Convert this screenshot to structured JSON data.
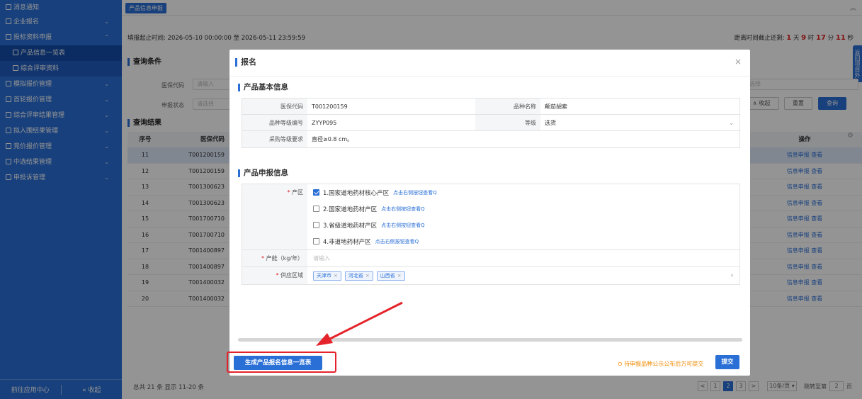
{
  "sidebar": {
    "items": [
      {
        "label": "消息通知",
        "icon": "notice-icon",
        "chevron": ""
      },
      {
        "label": "企业报名",
        "icon": "folder-icon",
        "chevron": "⌄"
      },
      {
        "label": "投标资料申报",
        "icon": "folder-icon",
        "chevron": "⌃"
      },
      {
        "label": "产品信息一览表",
        "icon": "doc-icon",
        "chevron": "",
        "sub": true,
        "active": true
      },
      {
        "label": "综合评审资料",
        "icon": "doc-icon",
        "chevron": "",
        "sub": true
      },
      {
        "label": "模拟报价管理",
        "icon": "folder-icon",
        "chevron": "⌄"
      },
      {
        "label": "首轮报价管理",
        "icon": "folder-icon",
        "chevron": "⌄"
      },
      {
        "label": "综合评审结果管理",
        "icon": "folder-icon",
        "chevron": "⌄"
      },
      {
        "label": "拟入围结果管理",
        "icon": "folder-icon",
        "chevron": "⌄"
      },
      {
        "label": "竞价报价管理",
        "icon": "folder-icon",
        "chevron": "⌄"
      },
      {
        "label": "中选结果管理",
        "icon": "folder-icon",
        "chevron": "⌄"
      },
      {
        "label": "申投诉管理",
        "icon": "folder-icon",
        "chevron": "⌄"
      }
    ],
    "footer_left": "前往应用中心",
    "footer_right": "« 收起"
  },
  "topbar": {
    "tab_label": "产品信息申报",
    "collapse_icon": "double-chevron-up-icon",
    "collapse_glyph": "︽"
  },
  "page": {
    "deadline_text": "填报起止时间: 2026-05-10 00:00:00 至 2026-05-11 23:59:59",
    "countdown_prefix": "距离时间截止还剩: ",
    "days": "1",
    "days_unit": " 天 ",
    "hours": "9",
    "hours_unit": " 时 ",
    "minutes": "17",
    "minutes_unit": " 分 ",
    "seconds": "11",
    "seconds_unit": " 秒",
    "side_tag": "返回项目外",
    "query_title": "查询条件",
    "filter_code_label": "医保代码",
    "filter_code_placeholder": "请输入",
    "filter_status_label": "申报状态",
    "filter_status_placeholder": "请选择",
    "filter_right_placeholder": "选择",
    "collapse_btn": "∧ 收起",
    "reset_btn": "重置",
    "search_btn": "查询",
    "result_title": "查询结果",
    "col_no": "序号",
    "col_code": "医保代码",
    "col_ops": "操作",
    "op_declare": "信息申报",
    "op_view": "查看",
    "rows": [
      {
        "no": "11",
        "code": "T001200159"
      },
      {
        "no": "12",
        "code": "T001200159"
      },
      {
        "no": "13",
        "code": "T001300623"
      },
      {
        "no": "14",
        "code": "T001300623"
      },
      {
        "no": "15",
        "code": "T001700710"
      },
      {
        "no": "16",
        "code": "T001700710"
      },
      {
        "no": "17",
        "code": "T001400897"
      },
      {
        "no": "18",
        "code": "T001400897"
      },
      {
        "no": "19",
        "code": "T001400032"
      },
      {
        "no": "20",
        "code": "T001400032"
      }
    ],
    "total_text": "总共 21 条 显示 11-20 条",
    "pager": {
      "prev": "<",
      "pages": [
        "1",
        "2",
        "3"
      ],
      "current": "2",
      "next": ">",
      "page_size": "10条/页 ▾",
      "jump_label": "跳转至第",
      "jump_value": "2",
      "jump_unit": "页"
    }
  },
  "modal": {
    "title": "报名",
    "close": "×",
    "basic_title": "产品基本信息",
    "basic": {
      "code_label": "医保代码",
      "code_value": "T001200159",
      "name_label": "品种名称",
      "name_value": "颠茄胡索",
      "grade_no_label": "品种等级编号",
      "grade_no_value": "ZYYP095",
      "grade_label": "等级",
      "grade_value": "选货",
      "req_label": "采购等级要求",
      "req_value": "直径≥0.8 cm。"
    },
    "declare_title": "产品申报信息",
    "area_label": "产区",
    "areas": [
      {
        "label": "1.国家道地药材核心产区",
        "checked": true
      },
      {
        "label": "2.国家道地药材产区",
        "checked": false
      },
      {
        "label": "3.省级道地药材产区",
        "checked": false
      },
      {
        "label": "4.非道地药材产区",
        "checked": false
      }
    ],
    "area_hint": "点击右侧按钮查看Q",
    "capacity_label": "产能（kg/年）",
    "capacity_placeholder": "请输入",
    "supply_label": "供应区域",
    "supply_tags": [
      "天津市",
      "河北省",
      "山西省"
    ],
    "generate_btn": "生成产品报名信息一览表",
    "notice": "⊙ 待申报品种公示公布后方可提交",
    "submit_btn": "提交"
  },
  "colors": {
    "primary": "#2a6fd6",
    "danger": "#e5232a",
    "warning": "#f08a00"
  }
}
